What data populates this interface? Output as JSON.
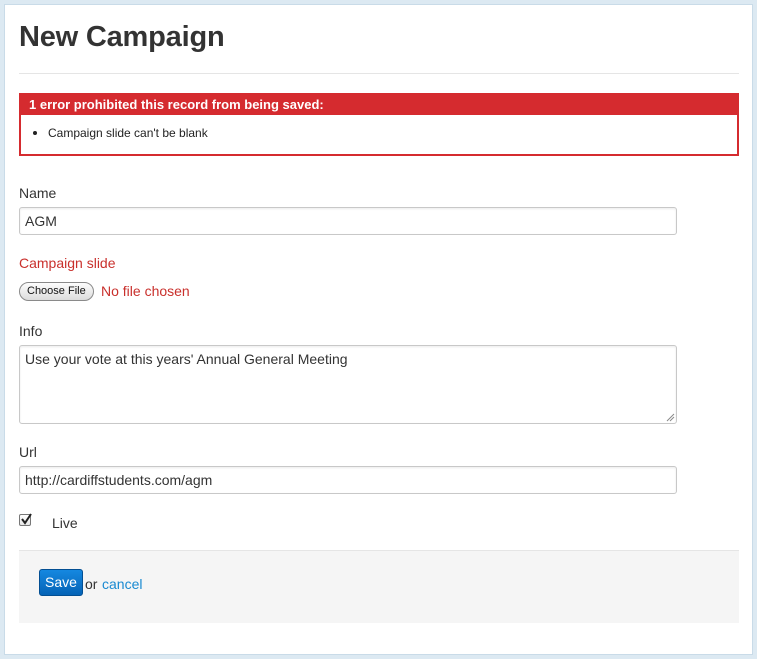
{
  "page": {
    "title": "New Campaign"
  },
  "errors": {
    "heading": "1 error prohibited this record from being saved:",
    "items": [
      "Campaign slide can't be blank"
    ]
  },
  "form": {
    "name": {
      "label": "Name",
      "value": "AGM"
    },
    "campaign_slide": {
      "label": "Campaign slide",
      "button_label": "Choose File",
      "status": "No file chosen"
    },
    "info": {
      "label": "Info",
      "value": "Use your vote at this years' Annual General Meeting"
    },
    "url": {
      "label": "Url",
      "value": "http://cardiffstudents.com/agm"
    },
    "live": {
      "label": "Live",
      "checked": true
    }
  },
  "actions": {
    "save_label": "Save",
    "or_text": "or",
    "cancel_label": "cancel"
  },
  "colors": {
    "error_red": "#d52b2f",
    "primary_blue": "#0a70c8",
    "link_blue": "#1a8ad1"
  }
}
